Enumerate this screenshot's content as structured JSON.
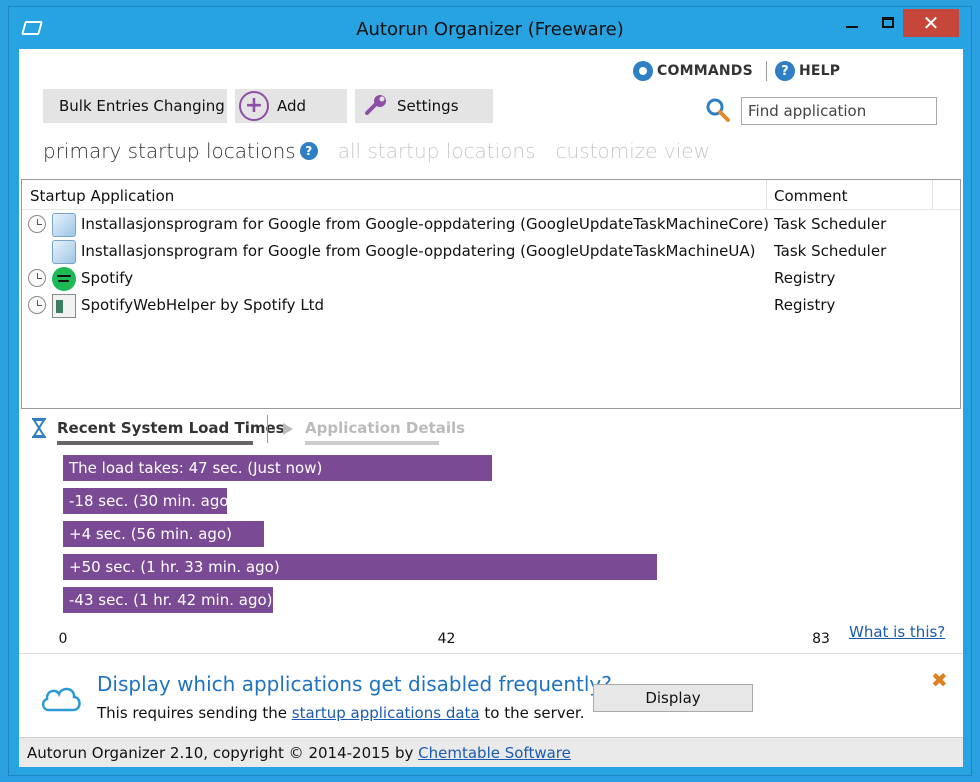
{
  "window": {
    "title": "Autorun Organizer (Freeware)",
    "minimize_icon": "minimize-icon",
    "maximize_icon": "maximize-icon",
    "close_label": "✕"
  },
  "header": {
    "commands_label": "COMMANDS",
    "help_label": "HELP"
  },
  "toolbar": {
    "bulk_label": "Bulk Entries Changing",
    "add_label": "Add",
    "settings_label": "Settings",
    "add_symbol": "+"
  },
  "search": {
    "placeholder": "Find application",
    "value": ""
  },
  "view_tabs": {
    "primary": "primary startup locations",
    "all": "all startup locations",
    "customize": "customize view",
    "help_symbol": "?"
  },
  "table": {
    "col_app": "Startup Application",
    "col_comment": "Comment",
    "rows": [
      {
        "name": "Installasjonsprogram for Google from Google-oppdatering (GoogleUpdateTaskMachineCore)",
        "comment": "Task Scheduler",
        "icon": "google-update-icon",
        "has_clock": true
      },
      {
        "name": "Installasjonsprogram for Google from Google-oppdatering (GoogleUpdateTaskMachineUA)",
        "comment": "Task Scheduler",
        "icon": "google-update-icon",
        "has_clock": false
      },
      {
        "name": "Spotify",
        "comment": "Registry",
        "icon": "spotify-icon",
        "has_clock": true
      },
      {
        "name": "SpotifyWebHelper by Spotify Ltd",
        "comment": "Registry",
        "icon": "spotify-helper-icon",
        "has_clock": true
      }
    ]
  },
  "bottom_tabs": {
    "recent": "Recent System Load Times",
    "details": "Application Details"
  },
  "chart_data": {
    "type": "bar",
    "orientation": "horizontal",
    "values": [
      47,
      18,
      22,
      65,
      23
    ],
    "labels": [
      "The load takes: 47 sec. (Just now)",
      "-18 sec. (30 min. ago)",
      "+4 sec. (56 min. ago)",
      "+50 sec. (1 hr. 33 min. ago)",
      "-43 sec. (1 hr. 42 min. ago)"
    ],
    "ticks": [
      "0",
      "42",
      "83"
    ],
    "xlim": [
      0,
      83
    ],
    "bar_color": "#7a4a94"
  },
  "what_link": "What is this?",
  "info": {
    "title": "Display which applications get disabled frequently?",
    "sub_prefix": "This requires sending the ",
    "sub_link": "startup applications data",
    "sub_suffix": " to the server.",
    "button": "Display",
    "close_symbol": "✖"
  },
  "status": {
    "prefix": "Autorun Organizer 2.10, copyright © 2014-2015 by ",
    "link": "Chemtable Software"
  }
}
